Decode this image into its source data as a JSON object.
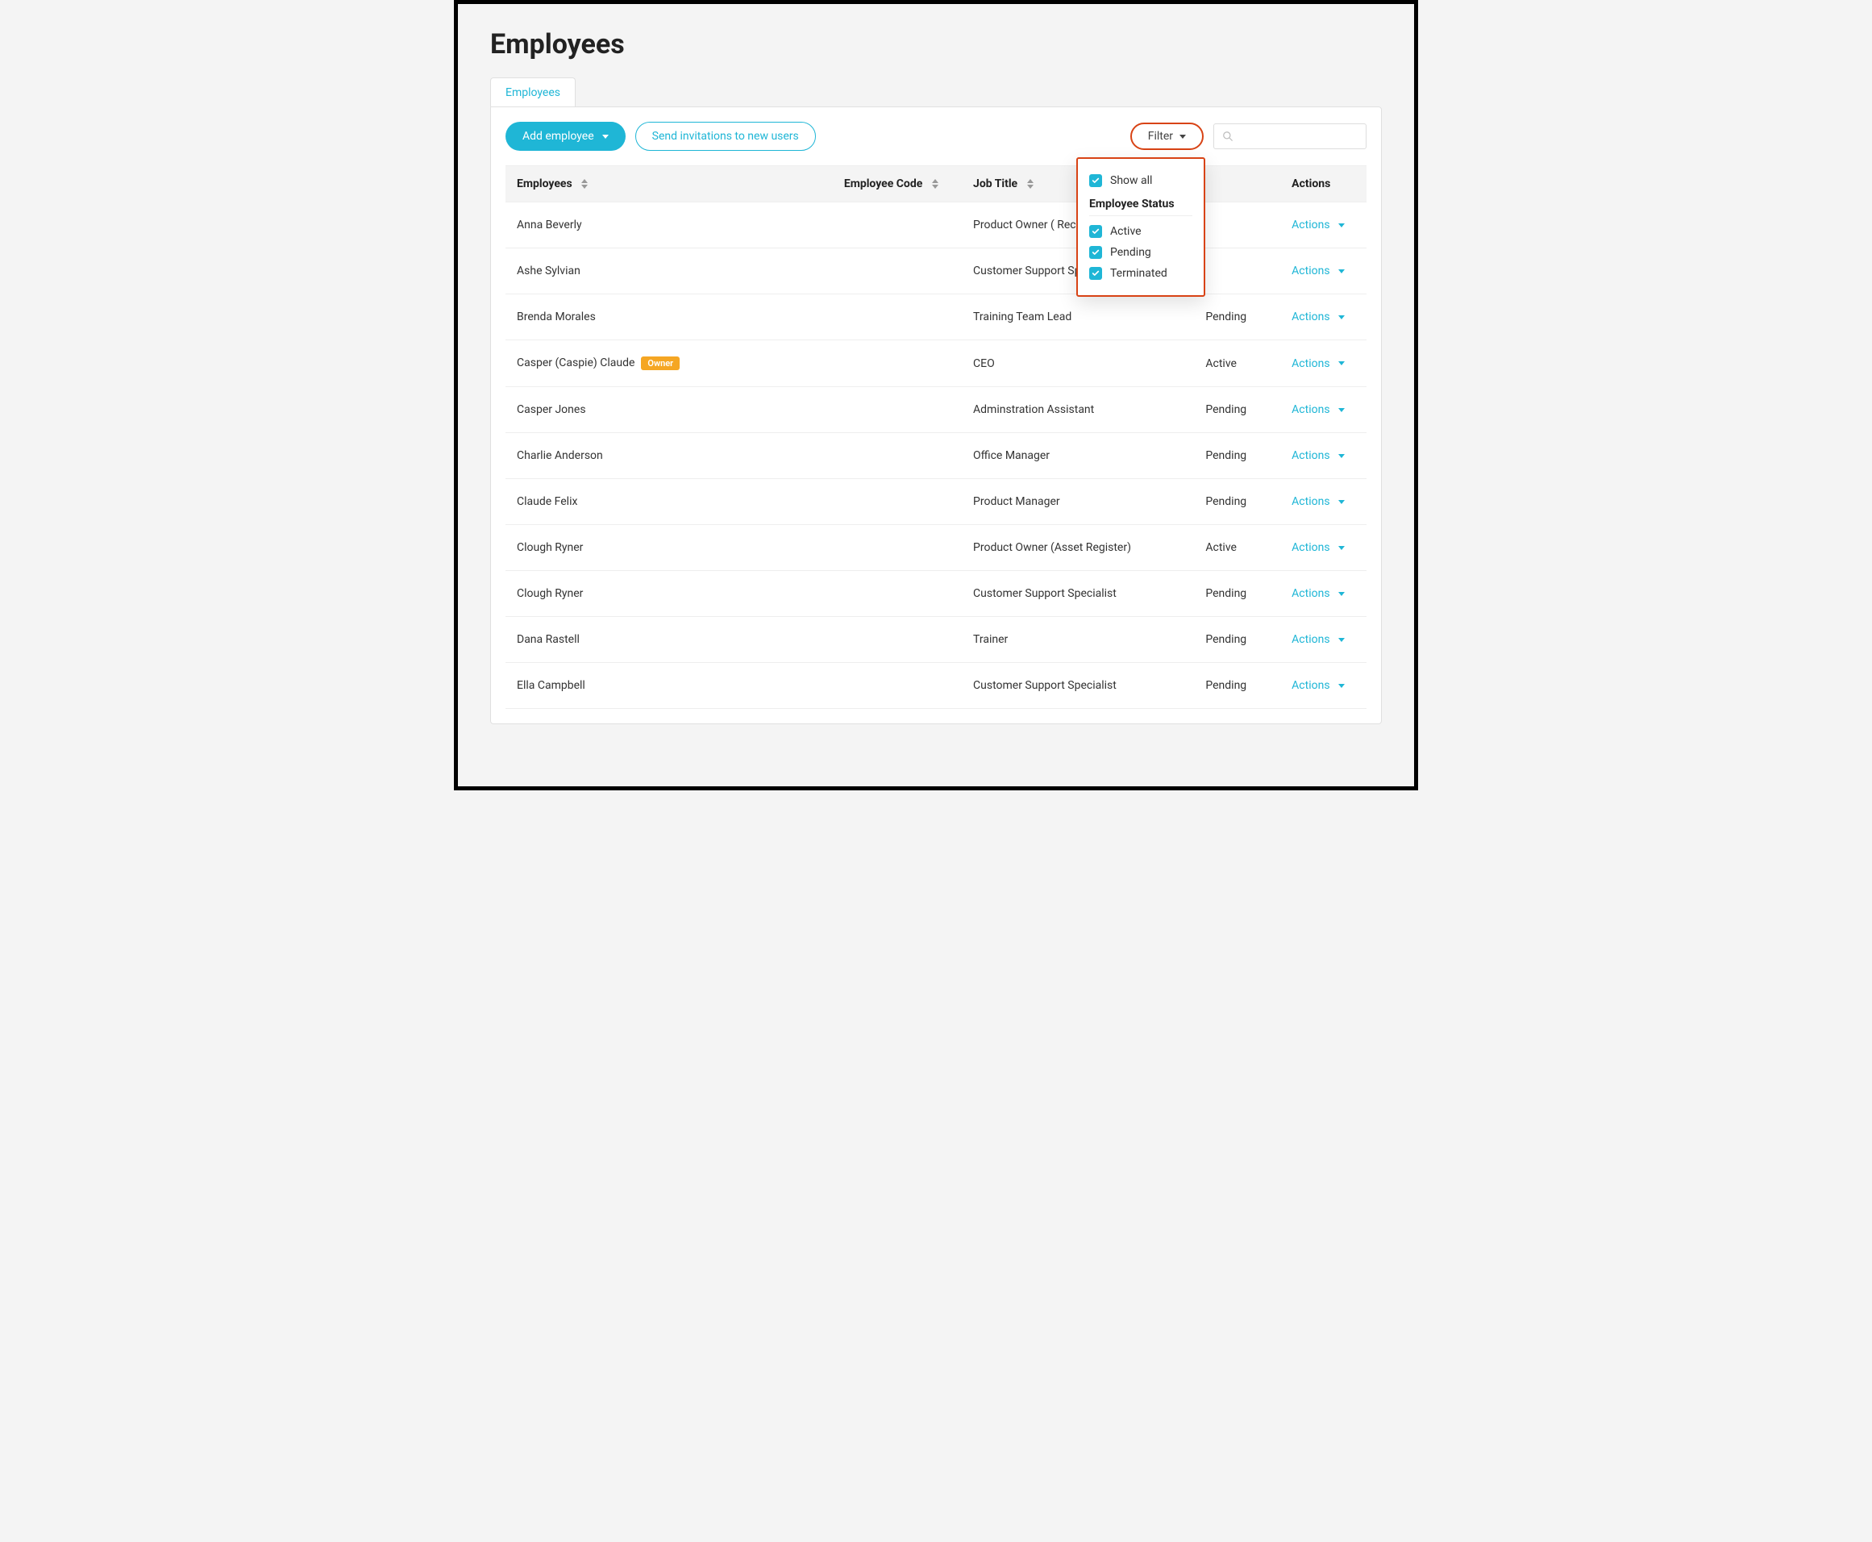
{
  "page": {
    "title": "Employees"
  },
  "tabs": {
    "employees": "Employees"
  },
  "toolbar": {
    "add_employee": "Add employee",
    "send_invitations": "Send invitations to new users",
    "filter": "Filter",
    "search_placeholder": ""
  },
  "filter_dropdown": {
    "show_all": "Show all",
    "section_title": "Employee Status",
    "options": [
      {
        "label": "Active",
        "checked": true
      },
      {
        "label": "Pending",
        "checked": true
      },
      {
        "label": "Terminated",
        "checked": true
      }
    ]
  },
  "columns": {
    "employees": "Employees",
    "employee_code": "Employee Code",
    "job_title": "Job Title",
    "status": "",
    "actions": "Actions"
  },
  "badges": {
    "owner": "Owner"
  },
  "actions_label": "Actions",
  "rows": [
    {
      "name": "Anna Beverly",
      "code": "",
      "title": "Product Owner ( Recognition )",
      "status": "",
      "owner": false
    },
    {
      "name": "Ashe Sylvian",
      "code": "",
      "title": "Customer Support Specialist",
      "status": "",
      "owner": false
    },
    {
      "name": "Brenda Morales",
      "code": "",
      "title": "Training Team Lead",
      "status": "Pending",
      "owner": false
    },
    {
      "name": "Casper (Caspie) Claude",
      "code": "",
      "title": "CEO",
      "status": "Active",
      "owner": true
    },
    {
      "name": "Casper Jones",
      "code": "",
      "title": "Adminstration Assistant",
      "status": "Pending",
      "owner": false
    },
    {
      "name": "Charlie Anderson",
      "code": "",
      "title": "Office Manager",
      "status": "Pending",
      "owner": false
    },
    {
      "name": "Claude Felix",
      "code": "",
      "title": "Product Manager",
      "status": "Pending",
      "owner": false
    },
    {
      "name": "Clough Ryner",
      "code": "",
      "title": "Product Owner (Asset Register)",
      "status": "Active",
      "owner": false
    },
    {
      "name": "Clough Ryner",
      "code": "",
      "title": "Customer Support Specialist",
      "status": "Pending",
      "owner": false
    },
    {
      "name": "Dana Rastell",
      "code": "",
      "title": "Trainer",
      "status": "Pending",
      "owner": false
    },
    {
      "name": "Ella Campbell",
      "code": "",
      "title": "Customer Support Specialist",
      "status": "Pending",
      "owner": false
    }
  ]
}
